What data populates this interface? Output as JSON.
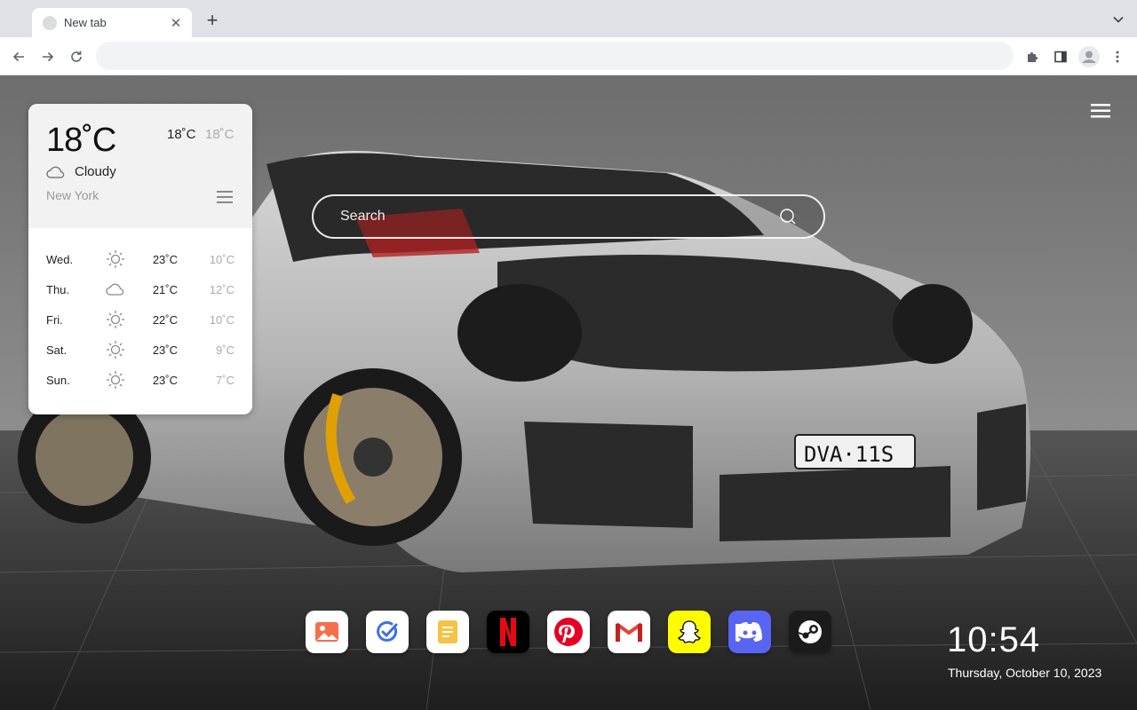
{
  "browser": {
    "tab_title": "New tab",
    "new_tab_symbol": "+",
    "close_symbol": "✕",
    "address_value": ""
  },
  "weather": {
    "current_temp": "18˚C",
    "high": "18˚C",
    "low": "18˚C",
    "condition": "Cloudy",
    "city": "New York",
    "forecast": [
      {
        "day": "Wed.",
        "icon": "sun-icon",
        "high": "23˚C",
        "low": "10˚C"
      },
      {
        "day": "Thu.",
        "icon": "cloud-icon",
        "high": "21˚C",
        "low": "12˚C"
      },
      {
        "day": "Fri.",
        "icon": "sun-icon",
        "high": "22˚C",
        "low": "10˚C"
      },
      {
        "day": "Sat.",
        "icon": "sun-icon",
        "high": "23˚C",
        "low": "9˚C"
      },
      {
        "day": "Sun.",
        "icon": "sun-icon",
        "high": "23˚C",
        "low": "7˚C"
      }
    ]
  },
  "search": {
    "placeholder": "Search"
  },
  "dock": {
    "apps": [
      "photos-app-icon",
      "todo-app-icon",
      "notes-app-icon",
      "netflix-icon",
      "pinterest-icon",
      "gmail-icon",
      "snapchat-icon",
      "discord-icon",
      "steam-icon"
    ]
  },
  "clock": {
    "time": "10:54",
    "date": "Thursday, October 10, 2023"
  },
  "colors": {
    "tabstrip": "#dee1e6",
    "netflix": "#e50914",
    "pinterest": "#e60023",
    "snapchat": "#fffc00",
    "discord": "#5865f2",
    "steam": "#1b1b1b"
  }
}
